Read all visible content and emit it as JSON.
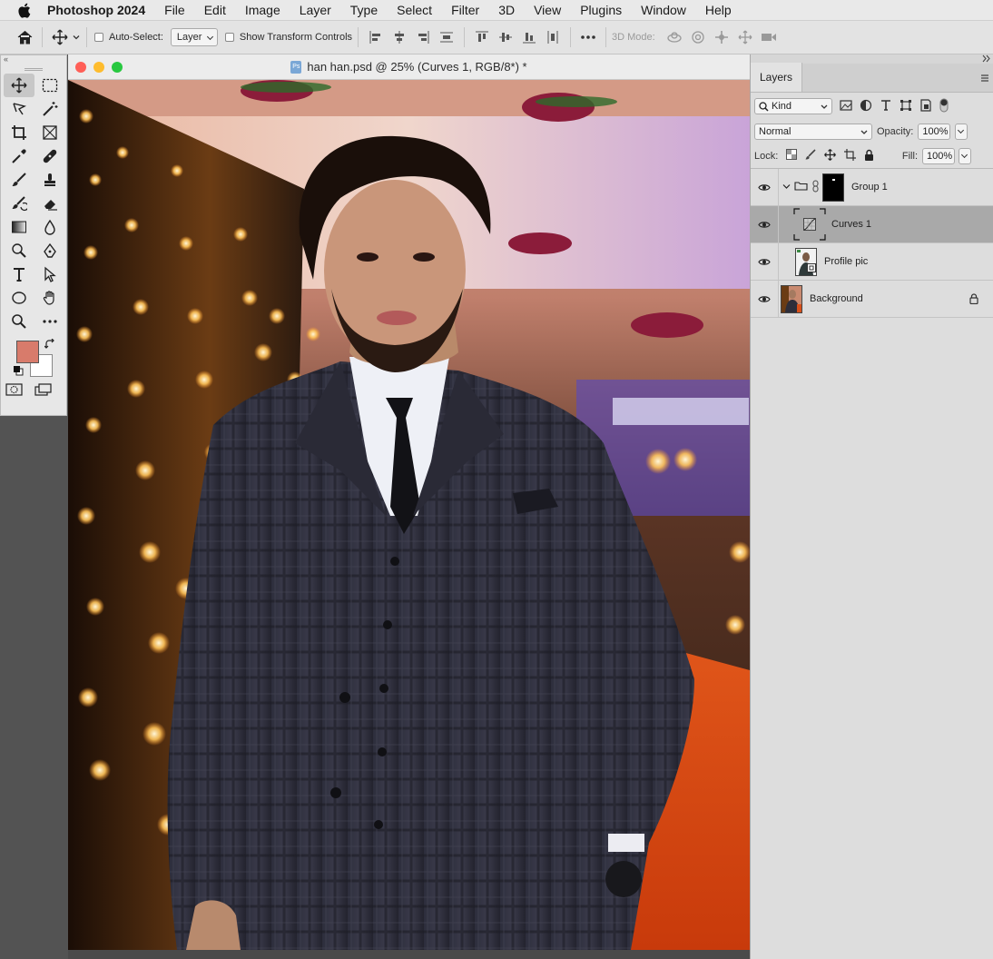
{
  "menubar": {
    "app_name": "Photoshop 2024",
    "items": [
      "File",
      "Edit",
      "Image",
      "Layer",
      "Type",
      "Select",
      "Filter",
      "3D",
      "View",
      "Plugins",
      "Window",
      "Help"
    ]
  },
  "options_bar": {
    "auto_select_label": "Auto-Select:",
    "auto_select_value": "Layer",
    "show_transform_label": "Show Transform Controls",
    "mode_3d_label": "3D Mode:"
  },
  "toolbar": {
    "collapse_glyph": "«",
    "foreground_color": "#d87b6b",
    "background_color": "#ffffff"
  },
  "document": {
    "title": "han han.psd @ 25% (Curves 1, RGB/8*) *",
    "file_badge": "Ps"
  },
  "layers_panel": {
    "tab_label": "Layers",
    "filter_kind": "Kind",
    "blend_mode": "Normal",
    "opacity_label": "Opacity:",
    "opacity_value": "100%",
    "lock_label": "Lock:",
    "fill_label": "Fill:",
    "fill_value": "100%",
    "layers": [
      {
        "name": "Group 1",
        "type": "group",
        "expanded": true,
        "has_mask": true
      },
      {
        "name": "Curves 1",
        "type": "adjustment",
        "selected": true
      },
      {
        "name": "Profile pic",
        "type": "smart-object"
      },
      {
        "name": "Background",
        "type": "pixel",
        "locked": true
      }
    ]
  },
  "colors": {
    "accent_selection": "#a9a9a9",
    "traffic_close": "#ff5f57",
    "traffic_minimize": "#febc2e",
    "traffic_zoom": "#28c840"
  }
}
